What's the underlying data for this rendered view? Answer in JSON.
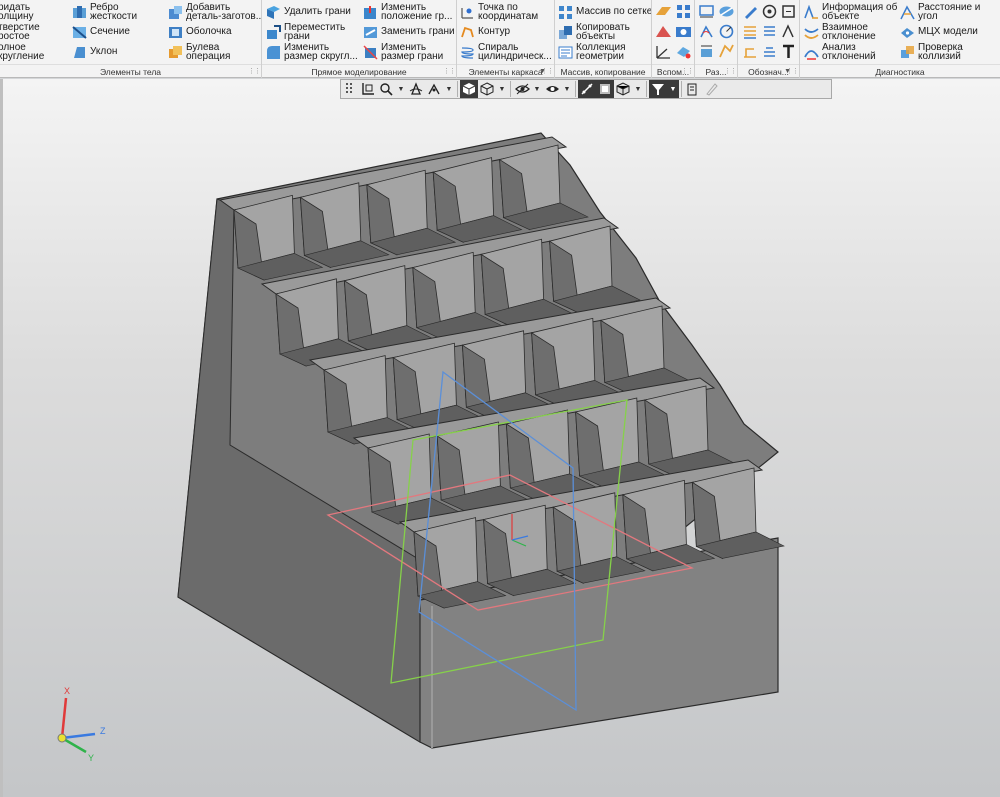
{
  "ribbon": {
    "groups": [
      {
        "label": "Элементы тела",
        "buttons": [
          {
            "line1": "ридать",
            "line2": "олщину",
            "icon": "shell-thicken-icon"
          },
          {
            "line1": "тверстие",
            "line2": "ростое",
            "icon": "hole-icon"
          },
          {
            "line1": "олное",
            "line2": "кругление",
            "icon": "fillet-icon"
          },
          {
            "line1": "Ребро",
            "line2": "жесткости",
            "icon": "rib-icon"
          },
          {
            "line1": "Сечение",
            "line2": "",
            "icon": "section-icon"
          },
          {
            "line1": "Уклон",
            "line2": "",
            "icon": "draft-icon"
          },
          {
            "line1": "Добавить",
            "line2": "деталь-заготов...",
            "icon": "add-blank-icon"
          },
          {
            "line1": "Оболочка",
            "line2": "",
            "icon": "shell-icon"
          },
          {
            "line1": "Булева",
            "line2": "операция",
            "icon": "boolean-icon"
          }
        ]
      },
      {
        "label": "Прямое моделирование",
        "buttons": [
          {
            "line1": "Удалить грани",
            "line2": "",
            "icon": "delete-faces-icon"
          },
          {
            "line1": "Переместить",
            "line2": "грани",
            "icon": "move-faces-icon"
          },
          {
            "line1": "Изменить",
            "line2": "размер скругл...",
            "icon": "resize-fillet-icon"
          },
          {
            "line1": "Изменить",
            "line2": "положение гр...",
            "icon": "face-position-icon"
          },
          {
            "line1": "Заменить грани",
            "line2": "",
            "icon": "replace-faces-icon"
          },
          {
            "line1": "Изменить",
            "line2": "размер грани",
            "icon": "resize-face-icon"
          }
        ]
      },
      {
        "label": "Элементы каркаса",
        "buttons": [
          {
            "line1": "Точка по",
            "line2": "координатам",
            "icon": "point-coords-icon"
          },
          {
            "line1": "Контур",
            "line2": "",
            "icon": "contour-icon"
          },
          {
            "line1": "Спираль",
            "line2": "цилиндрическ...",
            "icon": "spiral-icon"
          }
        ]
      },
      {
        "label": "Массив, копирование",
        "buttons": [
          {
            "line1": "Массив по сетке",
            "line2": "",
            "icon": "grid-array-icon"
          },
          {
            "line1": "Копировать",
            "line2": "объекты",
            "icon": "copy-objects-icon"
          },
          {
            "line1": "Коллекция",
            "line2": "геометрии",
            "icon": "geometry-collection-icon"
          }
        ]
      },
      {
        "label": "Вспом..."
      },
      {
        "label": "Раз..."
      },
      {
        "label": "Обознач..."
      },
      {
        "label": "Диагностика",
        "buttons": [
          {
            "line1": "Информация об",
            "line2": "объекте",
            "icon": "object-info-icon"
          },
          {
            "line1": "Взаимное",
            "line2": "отклонение",
            "icon": "mutual-deviation-icon"
          },
          {
            "line1": "Анализ",
            "line2": "отклонений",
            "icon": "deviation-analysis-icon"
          },
          {
            "line1": "Расстояние и",
            "line2": "угол",
            "icon": "distance-angle-icon"
          },
          {
            "line1": "МЦХ модели",
            "line2": "",
            "icon": "mass-properties-icon"
          },
          {
            "line1": "Проверка",
            "line2": "коллизий",
            "icon": "collision-check-icon"
          }
        ]
      }
    ]
  },
  "viewport": {
    "axes": {
      "x": "X",
      "y": "Y",
      "z": "Z"
    }
  },
  "colors": {
    "model_face": "#7d7d7d",
    "model_face_light": "#9a9a9a",
    "model_edge": "#2b2b2b",
    "plane_xy": "#e2787e",
    "plane_zy": "#86d14a",
    "plane_zx": "#5b8fd8",
    "axis_x": "#e03a3a",
    "axis_y": "#2fb34a",
    "axis_z": "#3a7ae0"
  }
}
